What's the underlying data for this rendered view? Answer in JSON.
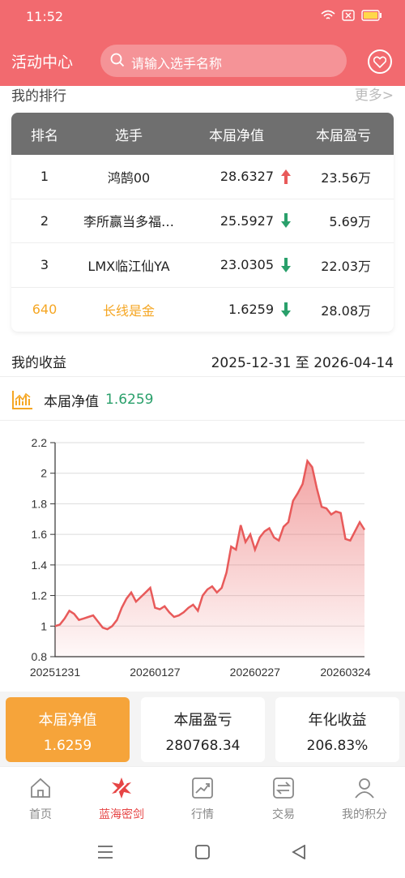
{
  "status": {
    "time": "11:52"
  },
  "header": {
    "title": "活动中心",
    "search_placeholder": "请输入选手名称"
  },
  "ranking": {
    "title": "我的排行",
    "more": "更多>",
    "columns": [
      "排名",
      "选手",
      "本届净值",
      "本届盈亏"
    ],
    "rows": [
      {
        "rank": "1",
        "player": "鸿鹄00",
        "nav": "28.6327",
        "trend": "up",
        "pnl": "23.56万"
      },
      {
        "rank": "2",
        "player": "李所赢当多福…",
        "nav": "25.5927",
        "trend": "down",
        "pnl": "5.69万"
      },
      {
        "rank": "3",
        "player": "LMX临江仙YA",
        "nav": "23.0305",
        "trend": "down",
        "pnl": "22.03万"
      },
      {
        "rank": "640",
        "player": "长线是金",
        "nav": "1.6259",
        "trend": "down",
        "pnl": "28.08万"
      }
    ]
  },
  "income": {
    "title": "我的收益",
    "range": "2025-12-31 至 2026-04-14"
  },
  "nav_label": {
    "label": "本届净值",
    "value": "1.6259"
  },
  "chart_data": {
    "type": "area",
    "x_ticks": [
      "20251231",
      "20260127",
      "20260227",
      "20260324"
    ],
    "y_ticks": [
      "0.8",
      "1",
      "1.2",
      "1.4",
      "1.6",
      "1.8",
      "2",
      "2.2"
    ],
    "ylim": [
      0.8,
      2.2
    ],
    "values": [
      1.0,
      1.01,
      1.05,
      1.1,
      1.08,
      1.04,
      1.05,
      1.06,
      1.07,
      1.03,
      0.99,
      0.98,
      1.0,
      1.04,
      1.12,
      1.18,
      1.22,
      1.16,
      1.19,
      1.22,
      1.25,
      1.12,
      1.11,
      1.13,
      1.09,
      1.06,
      1.07,
      1.09,
      1.12,
      1.14,
      1.1,
      1.2,
      1.24,
      1.26,
      1.22,
      1.25,
      1.35,
      1.52,
      1.5,
      1.66,
      1.55,
      1.6,
      1.5,
      1.58,
      1.62,
      1.64,
      1.58,
      1.56,
      1.65,
      1.68,
      1.82,
      1.87,
      1.93,
      2.08,
      2.04,
      1.9,
      1.78,
      1.77,
      1.73,
      1.75,
      1.74,
      1.57,
      1.56,
      1.62,
      1.68,
      1.63
    ],
    "color": "#e85a5a"
  },
  "stats": [
    {
      "title": "本届净值",
      "value": "1.6259"
    },
    {
      "title": "本届盈亏",
      "value": "280768.34"
    },
    {
      "title": "年化收益",
      "value": "206.83%"
    }
  ],
  "tabs": [
    {
      "label": "首页",
      "icon": "home-icon"
    },
    {
      "label": "蓝海密剑",
      "icon": "sword-icon"
    },
    {
      "label": "行情",
      "icon": "chart-icon"
    },
    {
      "label": "交易",
      "icon": "exchange-icon"
    },
    {
      "label": "我的积分",
      "icon": "user-icon"
    }
  ],
  "colors": {
    "brand": "#f26a6f",
    "up": "#e85a5a",
    "down": "#2aa06b",
    "mine": "#f5a623",
    "active_card": "#f6a43a"
  }
}
